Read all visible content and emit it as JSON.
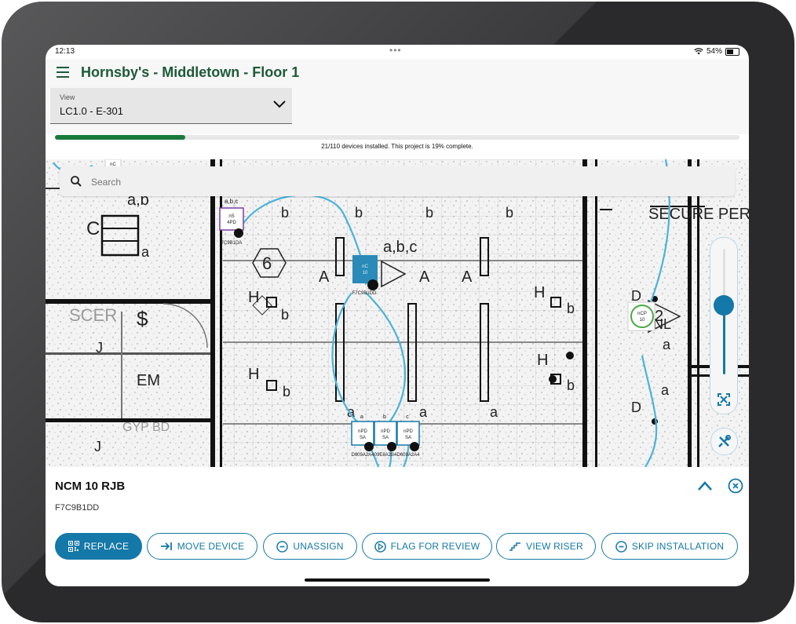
{
  "status_bar": {
    "time": "12:13",
    "dots": "•••",
    "battery": "54%"
  },
  "header": {
    "title": "Hornsby's - Middletown - Floor 1"
  },
  "view_select": {
    "label": "View",
    "value": "LC1.0 - E-301"
  },
  "progress": {
    "installed": 21,
    "total": 110,
    "percent": 19,
    "text": "21/110 devices installed. This project is 19% complete."
  },
  "search": {
    "placeholder": "Search"
  },
  "zoom": {
    "level": 0.55
  },
  "floorplan": {
    "plan_text": {
      "secure": "SECURE PER",
      "em_nl": "EM/NL",
      "em": "EM",
      "scer": "SCER",
      "gyp": "GYP BD",
      "abc_center": "a,b,c",
      "abc_top": "a,b,c",
      "ab": "a,b",
      "hex_num": "6",
      "tri_num": "2"
    },
    "devices": [
      {
        "label": "nS\n4PD",
        "id": "7C9B1DA"
      },
      {
        "label": "nC\n10",
        "id": "F7C9B1DD"
      },
      {
        "label": "nCP\n10",
        "id": ""
      },
      {
        "label": "nPD\nSA",
        "id": "D609A2A4"
      },
      {
        "label": "nPD\nSA",
        "id": "09E8A2B4"
      },
      {
        "label": "nPD\nSA",
        "id": "D609A2A4"
      }
    ],
    "device_tags": [
      "a",
      "b",
      "c"
    ],
    "top_badge": "nC"
  },
  "panel": {
    "device_name": "NCM 10 RJB",
    "device_id": "F7C9B1DD",
    "buttons": {
      "replace": "REPLACE",
      "move": "MOVE DEVICE",
      "unassign": "UNASSIGN",
      "flag": "FLAG FOR REVIEW",
      "riser": "VIEW RISER",
      "skip": "SKIP INSTALLATION"
    }
  },
  "colors": {
    "brand_green": "#1d5a37",
    "progress": "#1a7a3c",
    "accent": "#1478a8",
    "wire": "#4bb3d8"
  },
  "icons": [
    "menu-icon",
    "chevron-down-icon",
    "search-icon",
    "fit-screen-icon",
    "tools-icon",
    "chevron-up-icon",
    "close-circle-icon",
    "qr-code-icon",
    "move-arrow-icon",
    "minus-circle-icon",
    "flag-circle-icon",
    "riser-icon",
    "wifi-icon",
    "battery-icon"
  ]
}
